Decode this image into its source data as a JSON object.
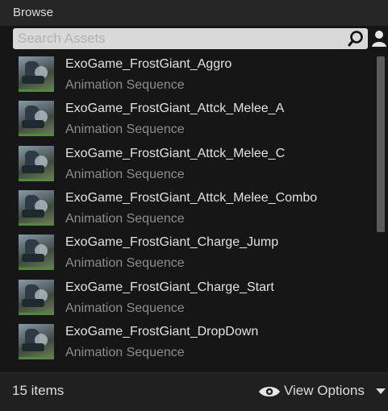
{
  "header": {
    "title": "Browse"
  },
  "search": {
    "placeholder": "Search Assets",
    "value": ""
  },
  "icons": {
    "search": "search-icon",
    "user": "user-icon",
    "eye": "eye-icon",
    "caret": "caret-down-icon"
  },
  "assets": [
    {
      "name": "ExoGame_FrostGiant_Aggro",
      "type": "Animation Sequence"
    },
    {
      "name": "ExoGame_FrostGiant_Attck_Melee_A",
      "type": "Animation Sequence"
    },
    {
      "name": "ExoGame_FrostGiant_Attck_Melee_C",
      "type": "Animation Sequence"
    },
    {
      "name": "ExoGame_FrostGiant_Attck_Melee_Combo",
      "type": "Animation Sequence"
    },
    {
      "name": "ExoGame_FrostGiant_Charge_Jump",
      "type": "Animation Sequence"
    },
    {
      "name": "ExoGame_FrostGiant_Charge_Start",
      "type": "Animation Sequence"
    },
    {
      "name": "ExoGame_FrostGiant_DropDown",
      "type": "Animation Sequence"
    }
  ],
  "footer": {
    "item_count": "15 items",
    "view_options_label": "View Options"
  },
  "colors": {
    "background": "#161616",
    "header": "#262626",
    "text": "#e2e2e2",
    "subtext": "#8d8d8d",
    "thumb_accent": "#4f8a3a"
  }
}
